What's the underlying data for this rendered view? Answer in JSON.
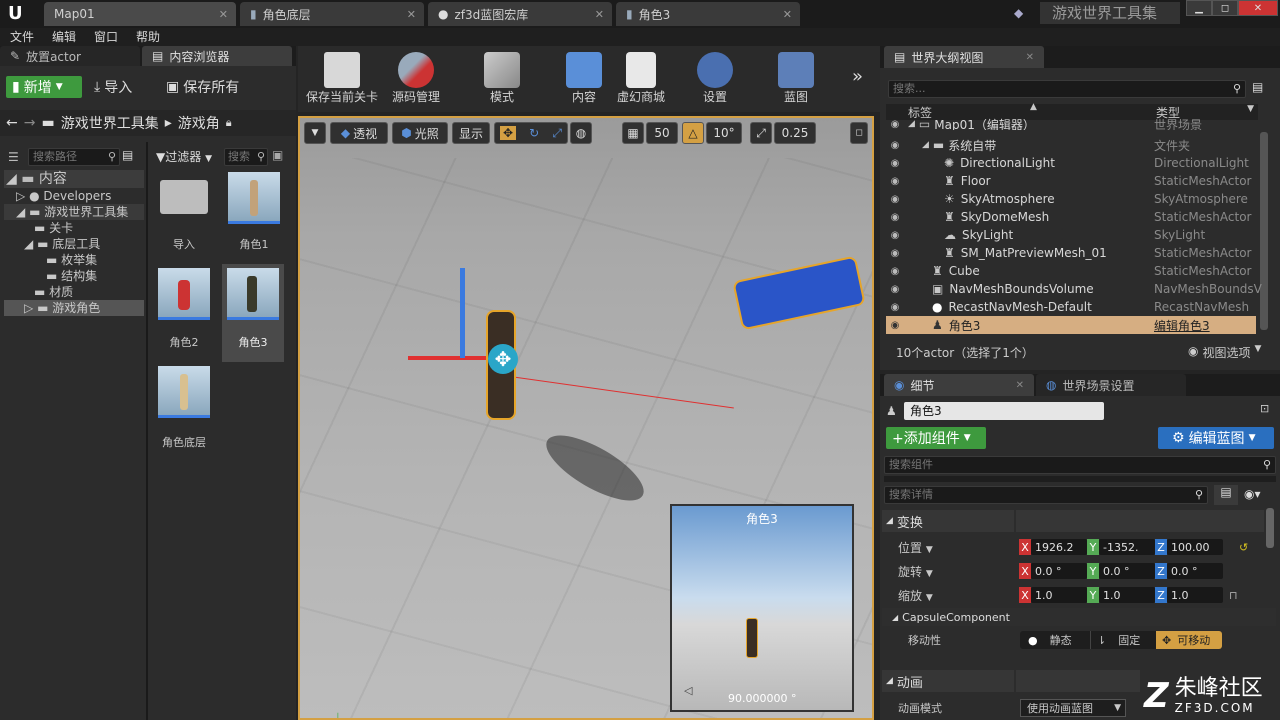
{
  "tabs": [
    {
      "label": "Map01"
    },
    {
      "label": "角色底层"
    },
    {
      "label": "zf3d蓝图宏库"
    },
    {
      "label": "角色3"
    }
  ],
  "project_title": "游戏世界工具集",
  "menu": [
    "文件",
    "编辑",
    "窗口",
    "帮助"
  ],
  "left_panel": {
    "tabs": [
      "放置actor",
      "内容浏览器"
    ],
    "add_new": "新增",
    "import": "导入",
    "save_all": "保存所有",
    "breadcrumb": [
      "游戏世界工具集",
      "游戏角"
    ],
    "search_path_placeholder": "搜索路径",
    "filter_label": "过滤器",
    "search_placeholder": "搜索",
    "tree": [
      {
        "label": "内容",
        "level": 0
      },
      {
        "label": "Developers",
        "level": 1
      },
      {
        "label": "游戏世界工具集",
        "level": 1
      },
      {
        "label": "关卡",
        "level": 2
      },
      {
        "label": "底层工具",
        "level": 2
      },
      {
        "label": "枚举集",
        "level": 3
      },
      {
        "label": "结构集",
        "level": 3
      },
      {
        "label": "材质",
        "level": 2
      },
      {
        "label": "游戏角色",
        "level": 1
      }
    ],
    "assets": [
      "导入",
      "角色1",
      "角色2",
      "角色3",
      "角色底层"
    ]
  },
  "toolbar": [
    {
      "label": "保存当前关卡",
      "icon": "save-icon"
    },
    {
      "label": "源码管理",
      "icon": "source-control-icon"
    },
    {
      "label": "模式",
      "icon": "modes-icon"
    },
    {
      "label": "内容",
      "icon": "content-icon"
    },
    {
      "label": "虚幻商城",
      "icon": "marketplace-icon"
    },
    {
      "label": "设置",
      "icon": "settings-icon"
    },
    {
      "label": "蓝图",
      "icon": "blueprint-icon"
    }
  ],
  "viewport": {
    "perspective": "透视",
    "lit": "光照",
    "show": "显示",
    "grid_snap": "50",
    "rot_snap": "10°",
    "scale_snap": "0.25",
    "preview_title": "角色3",
    "preview_fov": "90.000000 °"
  },
  "outliner": {
    "tab": "世界大纲视图",
    "search_placeholder": "搜索...",
    "col_label": "标签",
    "col_type": "类型",
    "rows": [
      {
        "name": "Map01（编辑器）",
        "type": "世界场景",
        "indent": 1
      },
      {
        "name": "系统自带",
        "type": "文件夹",
        "indent": 2
      },
      {
        "name": "DirectionalLight",
        "type": "DirectionalLight",
        "indent": 3
      },
      {
        "name": "Floor",
        "type": "StaticMeshActor",
        "indent": 3
      },
      {
        "name": "SkyAtmosphere",
        "type": "SkyAtmosphere",
        "indent": 3
      },
      {
        "name": "SkyDomeMesh",
        "type": "StaticMeshActor",
        "indent": 3
      },
      {
        "name": "SkyLight",
        "type": "SkyLight",
        "indent": 3
      },
      {
        "name": "SM_MatPreviewMesh_01",
        "type": "StaticMeshActor",
        "indent": 3
      },
      {
        "name": "Cube",
        "type": "StaticMeshActor",
        "indent": 2
      },
      {
        "name": "NavMeshBoundsVolume",
        "type": "NavMeshBoundsV",
        "indent": 2
      },
      {
        "name": "RecastNavMesh-Default",
        "type": "RecastNavMesh",
        "indent": 2
      },
      {
        "name": "角色3",
        "type": "编辑角色3",
        "indent": 2
      }
    ],
    "status": "10个actor（选择了1个）",
    "view_options": "视图选项"
  },
  "details": {
    "tabs": [
      "细节",
      "世界场景设置"
    ],
    "name_value": "角色3",
    "add_component": "+添加组件",
    "edit_blueprint": "编辑蓝图",
    "search_component_placeholder": "搜索组件",
    "search_details_placeholder": "搜索详情",
    "transform_header": "变换",
    "location_label": "位置",
    "rotation_label": "旋转",
    "scale_label": "缩放",
    "location": [
      "1926.2",
      "-1352.",
      "100.00"
    ],
    "rotation": [
      "0.0 °",
      "0.0 °",
      "0.0 °"
    ],
    "scale": [
      "1.0",
      "1.0",
      "1.0"
    ],
    "capsule_header": "CapsuleComponent",
    "mobility_label": "移动性",
    "mobility_options": [
      "静态",
      "固定",
      "可移动"
    ],
    "anim_header": "动画",
    "anim_mode_label": "动画模式",
    "anim_mode_value": "使用动画蓝图"
  },
  "watermark": {
    "line1": "朱峰社区",
    "line2": "ZF3D.COM"
  }
}
